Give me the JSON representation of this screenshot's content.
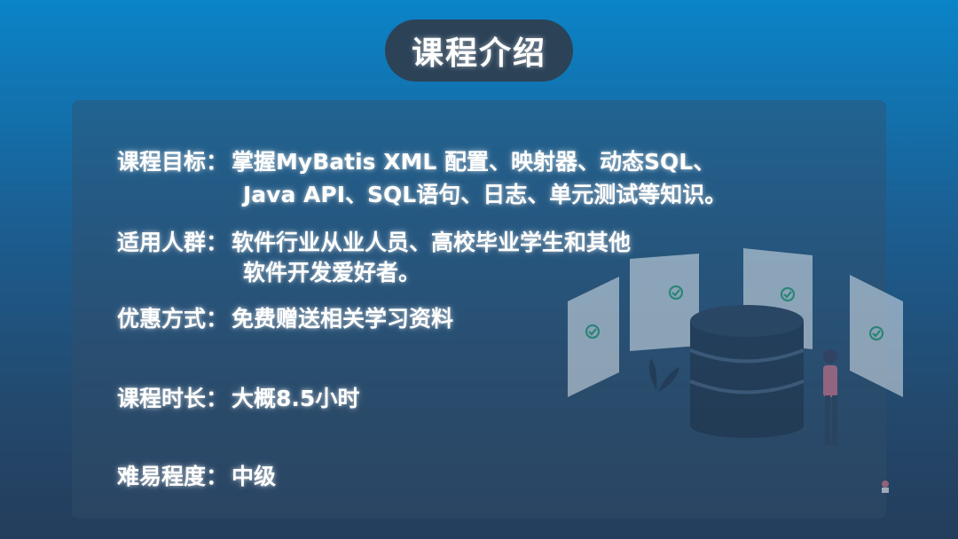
{
  "header": {
    "title": "课程介绍"
  },
  "colors": {
    "background_top": "#0a84c8",
    "background_bottom": "#243d5c",
    "title_pill": "#2c4257",
    "text": "#ffffff",
    "check_accent": "#2fb07a"
  },
  "details": {
    "goal": {
      "label": "课程目标",
      "colon": "：",
      "line1": "掌握MyBatis XML 配置、映射器、动态SQL、",
      "line2": "Java API、SQL语句、日志、单元测试等知识。"
    },
    "audience": {
      "label": "适用人群",
      "colon": "：",
      "line1": "软件行业从业人员、高校毕业学生和其他",
      "line2": "软件开发爱好者。"
    },
    "offer": {
      "label": "优惠方式",
      "colon": "：",
      "value": "免费赠送相关学习资料"
    },
    "duration": {
      "label": "课程时长",
      "colon": "：",
      "value": "大概8.5小时"
    },
    "difficulty": {
      "label": "难易程度",
      "colon": "：",
      "value": "中级"
    }
  },
  "illustration": {
    "icon": "database-server-icon",
    "card_icon": "check-circle-icon"
  }
}
